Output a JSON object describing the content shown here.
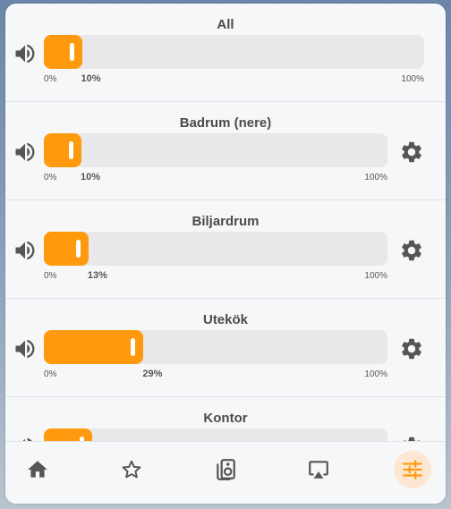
{
  "accent_color": "#ff9a0e",
  "rows": [
    {
      "name": "All",
      "value": 10,
      "value_label": "10%",
      "min_label": "0%",
      "max_label": "100%",
      "has_settings": false
    },
    {
      "name": "Badrum (nere)",
      "value": 10,
      "value_label": "10%",
      "min_label": "0%",
      "max_label": "100%",
      "has_settings": true
    },
    {
      "name": "Biljardrum",
      "value": 13,
      "value_label": "13%",
      "min_label": "0%",
      "max_label": "100%",
      "has_settings": true
    },
    {
      "name": "Utekök",
      "value": 29,
      "value_label": "29%",
      "min_label": "0%",
      "max_label": "100%",
      "has_settings": true
    },
    {
      "name": "Kontor",
      "value": 14,
      "value_label": "",
      "min_label": "",
      "max_label": "",
      "has_settings": true
    }
  ],
  "tabbar": {
    "tabs": [
      {
        "icon": "home-icon",
        "active": false
      },
      {
        "icon": "star-icon",
        "active": false
      },
      {
        "icon": "speaker-icon",
        "active": false
      },
      {
        "icon": "airplay-icon",
        "active": false
      },
      {
        "icon": "sliders-icon",
        "active": true
      }
    ]
  }
}
